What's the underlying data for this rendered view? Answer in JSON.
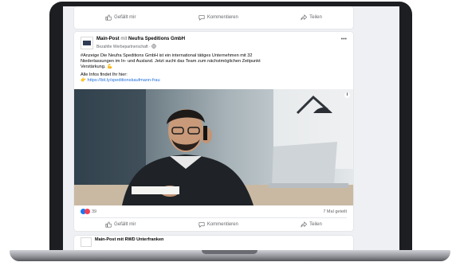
{
  "colors": {
    "link": "#216fdb",
    "like_blue": "#1877f2",
    "love_red": "#f33e58",
    "muted": "#65676b"
  },
  "top_actions": {
    "like": "Gefällt mir",
    "comment": "Kommentieren",
    "share": "Teilen"
  },
  "post": {
    "page_name": "Main-Post",
    "with_word": "mit",
    "partner_name": "Neufra Speditions GmbH",
    "subtitle": "Bezahlte Werbepartnerschaft · ",
    "line1": "#Anzeige Die Neufra Speditions GmbH ist ein international tätiges Unternehmen mit 32",
    "line2": "Niederlassungen im In- und Ausland. Jetzt sucht das Team zum nächstmöglichen Zeitpunkt",
    "line3": "Verstärkung. 💪",
    "line4": "Alle Infos findet Ihr hier:",
    "link": "https://bit.ly/speditionskaufmann-frau",
    "reaction_count": "39",
    "share_count": "7 Mal geteilt",
    "actions": {
      "like": "Gefällt mir",
      "comment": "Kommentieren",
      "share": "Teilen"
    }
  },
  "next_post": {
    "header_partial": "Main-Post mit RWD Unterfranken"
  }
}
